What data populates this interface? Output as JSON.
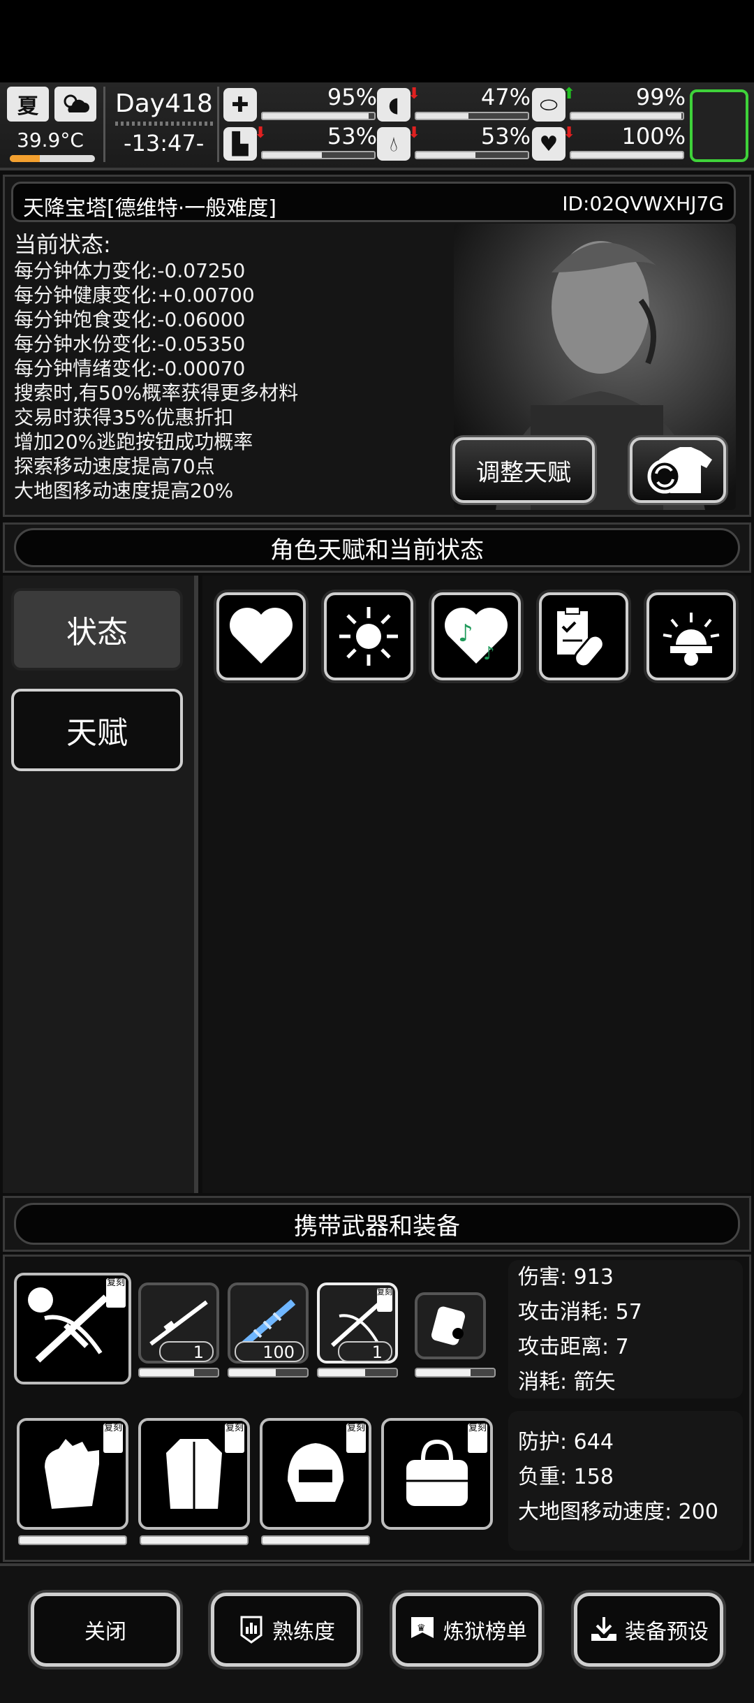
{
  "hud": {
    "season": "夏",
    "temperature": "39.9°C",
    "temperature_level": 0.35,
    "day": "Day418",
    "time": "-13:47-",
    "stats": [
      {
        "icon": "medkit-icon",
        "value": "95%",
        "level": 0.95,
        "trend": ""
      },
      {
        "icon": "stomach-icon",
        "value": "47%",
        "level": 0.47,
        "trend": "down"
      },
      {
        "icon": "pill-icon",
        "value": "99%",
        "level": 0.99,
        "trend": "up"
      },
      {
        "icon": "boot-icon",
        "value": "53%",
        "level": 0.53,
        "trend": "down"
      },
      {
        "icon": "water-drop-icon",
        "value": "53%",
        "level": 0.53,
        "trend": "down"
      },
      {
        "icon": "heart-icon",
        "value": "100%",
        "level": 1.0,
        "trend": "down"
      }
    ]
  },
  "info": {
    "title": "天降宝塔[德维特·一般难度]",
    "id": "ID:02QVWXHJ7G",
    "status_heading": "当前状态:",
    "status_lines": [
      "每分钟体力变化:-0.07250",
      "每分钟健康变化:+0.00700",
      "每分钟饱食变化:-0.06000",
      "每分钟水份变化:-0.05350",
      "每分钟情绪变化:-0.00070",
      "搜索时,有50%概率获得更多材料",
      "交易时获得35%优惠折扣",
      "增加20%逃跑按钮成功概率",
      "探索移动速度提高70点",
      "大地图移动速度提高20%"
    ],
    "adjust_talent_button": "调整天赋"
  },
  "talent_section": {
    "title": "角色天赋和当前状态",
    "tabs": [
      "状态",
      "天赋"
    ],
    "status_icons": [
      "heart-icon",
      "sun-icon",
      "music-heart-icon",
      "medicine-icon",
      "alarm-light-icon"
    ]
  },
  "equipment": {
    "title": "携带武器和装备",
    "copy_tag": "复刻",
    "weapon_counts": [
      "1",
      "100",
      "1"
    ],
    "weapon_stats": [
      "伤害: 913",
      "攻击消耗: 57",
      "攻击距离: 7",
      "消耗: 箭矢"
    ],
    "armor_stats": [
      "防护: 644",
      "负重: 158",
      "大地图移动速度: 200"
    ]
  },
  "footer": {
    "buttons": [
      "关闭",
      "熟练度",
      "炼狱榜单",
      "装备预设"
    ]
  },
  "colors": {
    "accent_green": "#3fd23a",
    "temp_bar": "#f3a02f",
    "trend_down": "#e02020",
    "trend_up": "#22c022"
  }
}
